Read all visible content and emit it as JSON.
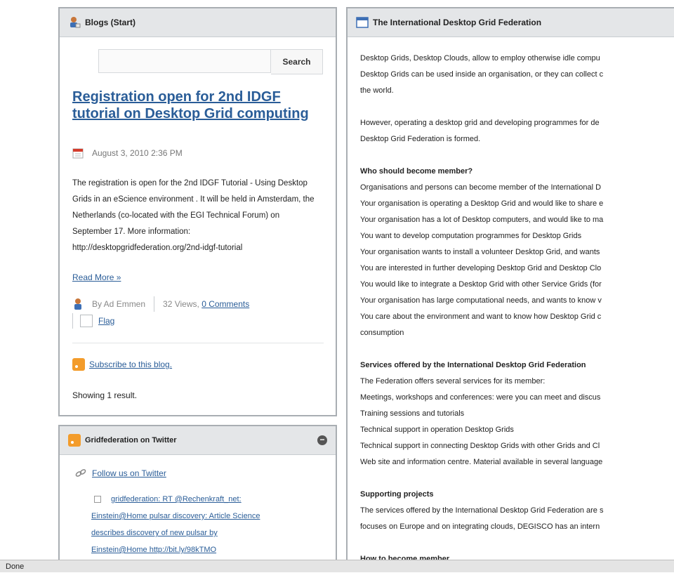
{
  "blog": {
    "title": "Blogs (Start)",
    "search_placeholder": "",
    "search_label": "Search",
    "post_title": "Registration open for 2nd IDGF tutorial on Desktop Grid computing",
    "post_date": "August 3, 2010 2:36 PM",
    "post_body": "The registration is open for the 2nd IDGF Tutorial - Using Desktop Grids in an eScience environment . It will be held in Amsterdam, the Netherlands (co-located with the EGI Technical Forum) on September 17. More information: http://desktopgridfederation.org/2nd-idgf-tutorial",
    "read_more": "Read More »",
    "author": "By Ad Emmen",
    "views": "32 Views,",
    "comments": "0 Comments",
    "flag": "Flag",
    "subscribe": "Subscribe to this blog.",
    "showing": "Showing 1 result."
  },
  "twitter": {
    "title": "Gridfederation on Twitter",
    "follow": "Follow us on Twitter",
    "tweet_lines": [
      "gridfederation: RT @Rechenkraft_net:",
      "Einstein@Home pulsar discovery: Article Science",
      "describes discovery of new pulsar by",
      "Einstein@Home http://bit.ly/98kTMO"
    ]
  },
  "fed": {
    "title": "The International Desktop Grid Federation",
    "lines": [
      {
        "t": "Desktop Grids, Desktop Clouds, allow to employ otherwise idle compu",
        "b": false
      },
      {
        "t": "Desktop Grids can be used inside an organisation, or they can collect c",
        "b": false
      },
      {
        "t": "the world.",
        "b": false
      },
      {
        "t": "",
        "b": false
      },
      {
        "t": "However, operating a desktop grid and developing programmes for de",
        "b": false
      },
      {
        "t": "Desktop Grid Federation is formed.",
        "b": false
      },
      {
        "t": "",
        "b": false
      },
      {
        "t": "Who should become member?",
        "b": true
      },
      {
        "t": "Organisations and persons can become member of the International D",
        "b": false
      },
      {
        "t": "Your organisation is operating a Desktop Grid and would like to share e",
        "b": false
      },
      {
        "t": "Your organisation has a lot of Desktop computers, and would like to ma",
        "b": false
      },
      {
        "t": "You want to develop computation programmes for Desktop Grids",
        "b": false
      },
      {
        "t": "Your organisation wants to install a volunteer Desktop Grid, and wants",
        "b": false
      },
      {
        "t": "You are interested in further developing Desktop Grid and Desktop Clo",
        "b": false
      },
      {
        "t": "You would like to integrate a Desktop Grid with other Service Grids (for",
        "b": false
      },
      {
        "t": "Your organisation has large computational needs, and wants to know v",
        "b": false
      },
      {
        "t": "You care about the environment and want to know how Desktop Grid c",
        "b": false
      },
      {
        "t": "consumption",
        "b": false
      },
      {
        "t": "",
        "b": false
      },
      {
        "t": "Services offered by the International Desktop Grid Federation",
        "b": true
      },
      {
        "t": "The Federation offers several services for its member:",
        "b": false
      },
      {
        "t": "Meetings, workshops and conferences: were you can meet and discus",
        "b": false
      },
      {
        "t": "Training sessions and tutorials",
        "b": false
      },
      {
        "t": "Technical support in operation Desktop Grids",
        "b": false
      },
      {
        "t": "Technical support in connecting Desktop Grids with other Grids and Cl",
        "b": false
      },
      {
        "t": "Web site and information centre. Material available in several language",
        "b": false
      },
      {
        "t": "",
        "b": false
      },
      {
        "t": "Supporting projects",
        "b": true
      },
      {
        "t": "The services offered by the International Desktop Grid Federation are s",
        "b": false
      },
      {
        "t": "focuses on Europe and on integrating clouds, DEGISCO has an intern",
        "b": false
      },
      {
        "t": "",
        "b": false
      },
      {
        "t": "How to become member",
        "b": true
      }
    ]
  },
  "status": "Done"
}
